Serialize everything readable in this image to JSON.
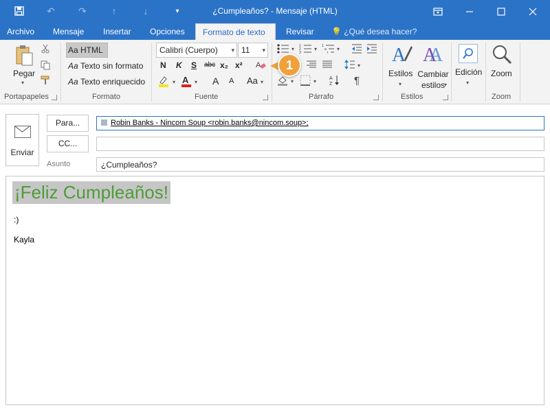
{
  "window": {
    "title": "¿Cumpleaños? - Mensaje (HTML)",
    "controls": [
      "restore-ribbon",
      "minimize",
      "maximize",
      "close"
    ]
  },
  "quick_access": [
    "save-icon",
    "undo-icon",
    "redo-icon",
    "up-arrow-icon",
    "down-arrow-icon",
    "customize-icon"
  ],
  "tabs": [
    {
      "label": "Archivo",
      "active": false
    },
    {
      "label": "Mensaje",
      "active": false
    },
    {
      "label": "Insertar",
      "active": false
    },
    {
      "label": "Opciones",
      "active": false
    },
    {
      "label": "Formato de texto",
      "active": true
    },
    {
      "label": "Revisar",
      "active": false
    }
  ],
  "tell_me": "¿Qué desea hacer?",
  "ribbon": {
    "portapapeles": {
      "label": "Portapapeles",
      "paste": "Pegar"
    },
    "formato": {
      "label": "Formato",
      "html": "HTML",
      "plain": "Texto sin formato",
      "rich": "Texto enriquecido",
      "aa": "Aa"
    },
    "fuente": {
      "label": "Fuente",
      "font_name": "Calibri (Cuerpo)",
      "font_size": "11",
      "bold": "N",
      "italic": "K",
      "underline": "S",
      "strike": "abc",
      "subscript": "x₂",
      "superscript": "x²",
      "grow": "A",
      "shrink": "A",
      "change_case": "Aa"
    },
    "parrafo": {
      "label": "Párrafo"
    },
    "estilos": {
      "label": "Estilos",
      "styles": "Estilos",
      "change_styles": "Cambiar estilos"
    },
    "edicion": {
      "label": "Edición"
    },
    "zoom": {
      "label": "Zoom",
      "button": "Zoom"
    }
  },
  "callout": "1",
  "header": {
    "send": "Enviar",
    "to_button": "Para...",
    "cc_button": "CC...",
    "to_value": "Robin Banks - Nincom Soup <robin.banks@nincom.soup>;",
    "cc_value": "",
    "subject_label": "Asunto",
    "subject_value": "¿Cumpleaños?"
  },
  "body": {
    "headline": "¡Feliz Cumpleaños!",
    "line1": ":)",
    "signature": "Kayla"
  },
  "colors": {
    "titlebar": "#2b73c7",
    "headline_text": "#4f9b3a",
    "highlight": "#c6c6c6",
    "callout": "#f0a13c"
  }
}
